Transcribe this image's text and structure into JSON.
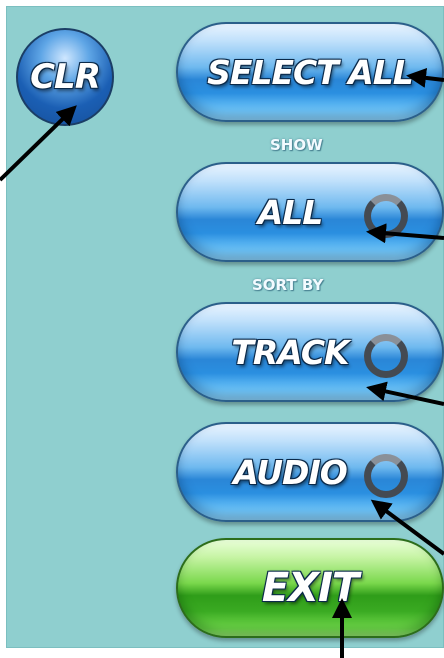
{
  "buttons": {
    "clr": "CLR",
    "select_all": "SELECT ALL",
    "show_all": "ALL",
    "sort_track": "TRACK",
    "sort_audio": "AUDIO",
    "exit": "EXIT"
  },
  "labels": {
    "show": "SHOW",
    "sort_by": "SORT BY"
  },
  "icons": {
    "cycle": "cycle-icon",
    "callout_arrow": "arrow-icon"
  },
  "colors": {
    "background": "#8fcfcf",
    "button_blue": "#2a86d7",
    "button_green": "#2f9d19",
    "label_text": "#f3fbff",
    "arrow": "#000000"
  }
}
